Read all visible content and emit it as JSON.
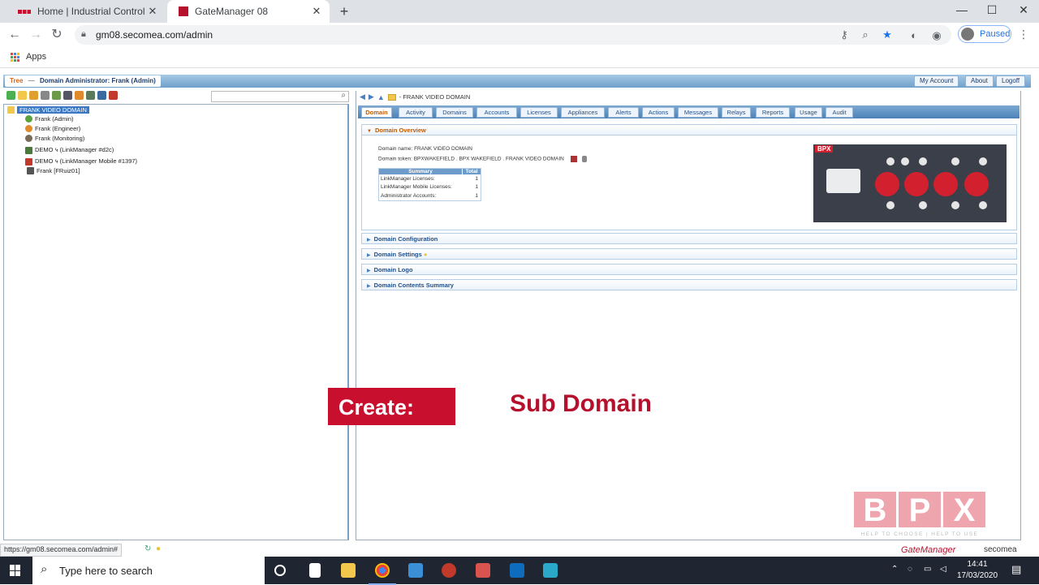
{
  "browser": {
    "tabs": [
      {
        "title": "Home | Industrial Control & Auto",
        "close": "✕"
      },
      {
        "title": "GateManager 08",
        "close": "✕"
      }
    ],
    "new_tab": "+",
    "window_controls": {
      "minimize": "—",
      "maximize": "☐",
      "close": "✕"
    },
    "url": "gm08.secomea.com/admin",
    "profile_status": "Paused",
    "bookmarks": [
      {
        "label": "Apps"
      }
    ]
  },
  "gm": {
    "breadcrumb_tree": "Tree",
    "breadcrumb_sep": "—",
    "breadcrumb_admin": "Domain Administrator: Frank (Admin)",
    "top_buttons": [
      "My Account",
      "About",
      "Logoff"
    ],
    "tree": [
      {
        "label": "FRANK VIDEO DOMAIN",
        "icon": "folder-icon",
        "color": "#f3c74c"
      },
      {
        "label": "Frank (Admin)",
        "icon": "user-admin-icon",
        "color": "#5aa23a"
      },
      {
        "label": "Frank (Engineer)",
        "icon": "user-icon",
        "color": "#e08a2c"
      },
      {
        "label": "Frank (Monitoring)",
        "icon": "user-icon",
        "color": "#7a6a5a"
      },
      {
        "label": "DEMO ५ (LinkManager #d2c)",
        "icon": "linkmanager-icon",
        "color": "#4a7a3a"
      },
      {
        "label": "DEMO ५ (LinkManager Mobile #1397)",
        "icon": "linkmanager-mobile-icon",
        "color": "#c0392b"
      },
      {
        "label": "Frank [FRuiz01]",
        "icon": "appliance-icon",
        "color": "#555555"
      }
    ],
    "path": "- FRANK VIDEO DOMAIN",
    "tabs": [
      "Domain",
      "Activity",
      "Domains",
      "Accounts",
      "Licenses",
      "Appliances",
      "Alerts",
      "Actions",
      "Messages",
      "Relays",
      "Reports",
      "Usage",
      "Audit"
    ],
    "overview": {
      "header": "Domain Overview",
      "domain_name": "Domain name: FRANK VIDEO DOMAIN",
      "domain_token": "Domain token: BPXWAKEFIELD . BPX WAKEFIELD . FRANK VIDEO DOMAIN",
      "summary_header": "Summary",
      "total_header": "Total",
      "summary_rows": [
        {
          "label": "LinkManager Licenses:",
          "value": "1"
        },
        {
          "label": "LinkManager Mobile Licenses:",
          "value": "1"
        },
        {
          "label": "Administrator Accounts:",
          "value": "1"
        }
      ],
      "banner_logo": "BPX"
    },
    "sections": [
      "Domain Configuration",
      "Domain Settings",
      "Domain Logo",
      "Domain Contents Summary"
    ],
    "status_url": "https://gm08.secomea.com/admin#",
    "brand": "GateManager",
    "vendor": "secomea"
  },
  "overlay": {
    "create": "Create:",
    "subject": "Sub Domain",
    "watermark": [
      "B",
      "P",
      "X"
    ],
    "tagline": "HELP TO CHOOSE | HELP TO USE"
  },
  "taskbar": {
    "search_placeholder": "Type here to search",
    "time": "14:41",
    "date": "17/03/2020"
  },
  "colors": {
    "accent_red": "#c8102e",
    "gm_blue": "#4b82b8",
    "chrome_tab_strip": "#dee1e6",
    "taskbar": "#1f2631"
  }
}
